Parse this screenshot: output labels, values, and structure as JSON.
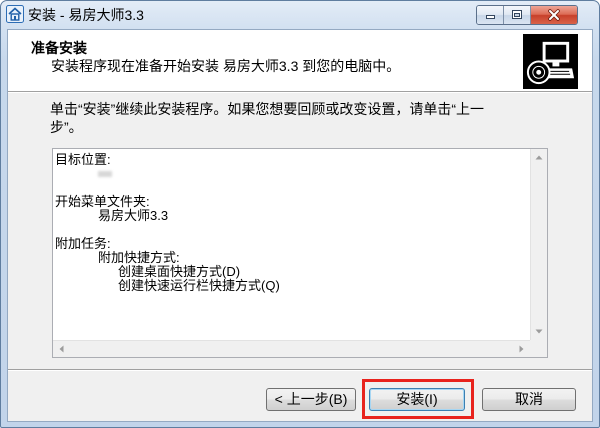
{
  "window": {
    "title": "安装 - 易房大师3.3",
    "app_icon": "app-icon",
    "control_icons": [
      "minimize-icon",
      "maximize-icon",
      "close-icon"
    ]
  },
  "header": {
    "title": "准备安装",
    "subtitle": "安装程序现在准备开始安装 易房大师3.3 到您的电脑中。",
    "icon": "setup-computer-icon"
  },
  "instructions": [
    "单击“安装”继续此安装程序。如果您想要回顾或改变设置，请单击“上一",
    "步”。"
  ],
  "summary": {
    "destination_heading": "目标位置:",
    "start_menu_heading": "开始菜单文件夹:",
    "start_menu_folder": "易房大师3.3",
    "tasks_heading": "附加任务:",
    "tasks_group": "附加快捷方式:",
    "tasks": [
      "创建桌面快捷方式(D)",
      "创建快速运行栏快捷方式(Q)"
    ],
    "scroll_icons": [
      "arrow-up-icon",
      "arrow-down-icon",
      "arrow-left-icon",
      "arrow-right-icon"
    ]
  },
  "buttons": {
    "back": "< 上一步(B)",
    "install": "安装(I)",
    "cancel": "取消"
  },
  "colors": {
    "annotation": "#e8231d",
    "close_button": "#c7402a",
    "default_button_border": "#3c7fb1",
    "window_frame": "#c7d8ec"
  }
}
